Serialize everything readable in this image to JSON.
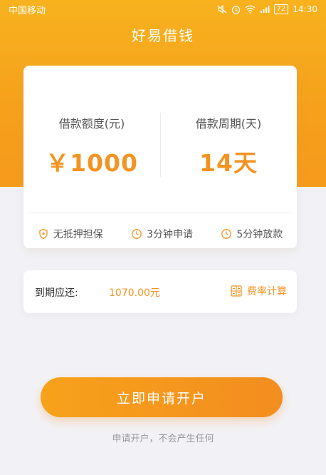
{
  "status_bar": {
    "carrier": "中国移动",
    "battery": "72",
    "time": "14:30",
    "icons": [
      "mute-icon",
      "alarm-icon",
      "wifi-icon",
      "signal-icon",
      "battery-icon"
    ]
  },
  "header": {
    "title": "好易借钱"
  },
  "loan_card": {
    "amount_label": "借款额度(元)",
    "amount_value": "￥1000",
    "period_label": "借款周期(天)",
    "period_value": "14天",
    "features": [
      {
        "icon": "shield-icon",
        "label": "无抵押担保"
      },
      {
        "icon": "clock-icon",
        "label": "3分钟申请"
      },
      {
        "icon": "clock-icon",
        "label": "5分钟放款"
      }
    ]
  },
  "repay": {
    "label": "到期应还:",
    "amount": "1070.00元",
    "rate_calc_label": "费率计算",
    "rate_calc_icon": "calculator-icon"
  },
  "apply": {
    "button_label": "立即申请开户",
    "note": "申请开户，不会产生任何"
  },
  "colors": {
    "primary": "#f6a11c",
    "accent_text": "#f39321",
    "background": "#f2f2f6"
  }
}
